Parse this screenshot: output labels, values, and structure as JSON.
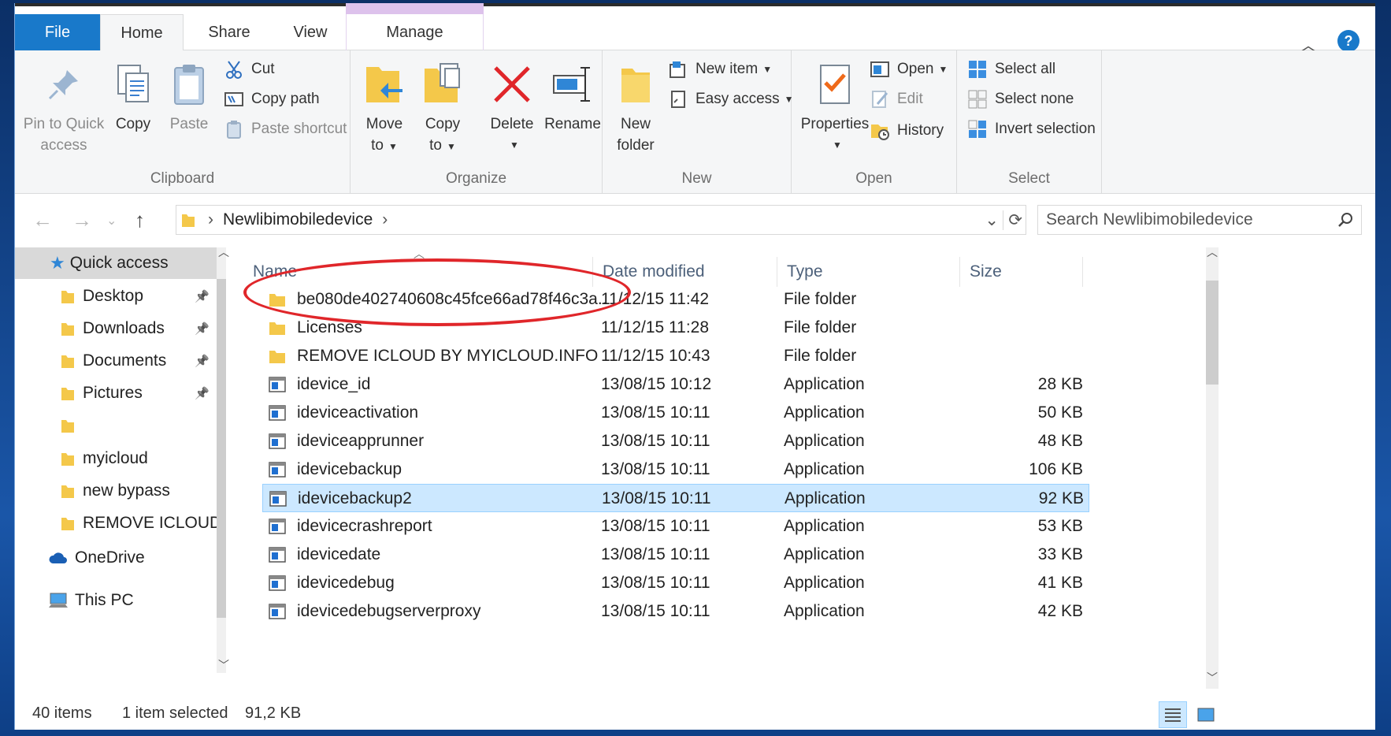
{
  "tabs": {
    "file": "File",
    "home": "Home",
    "share": "Share",
    "view": "View",
    "manage": "Manage"
  },
  "ribbon": {
    "clipboard": {
      "label": "Clipboard",
      "pin_line1": "Pin to Quick",
      "pin_line2": "access",
      "copy": "Copy",
      "paste": "Paste",
      "cut": "Cut",
      "copy_path": "Copy path",
      "paste_shortcut": "Paste shortcut"
    },
    "organize": {
      "label": "Organize",
      "move_line1": "Move",
      "move_line2": "to",
      "copy_line1": "Copy",
      "copy_line2": "to",
      "delete": "Delete",
      "rename": "Rename"
    },
    "new": {
      "label": "New",
      "folder_line1": "New",
      "folder_line2": "folder",
      "new_item": "New item",
      "easy_access": "Easy access"
    },
    "open": {
      "label": "Open",
      "properties": "Properties",
      "open": "Open",
      "edit": "Edit",
      "history": "History"
    },
    "select": {
      "label": "Select",
      "select_all": "Select all",
      "select_none": "Select none",
      "invert": "Invert selection"
    }
  },
  "address": {
    "path": "Newlibimobiledevice",
    "search_placeholder": "Search Newlibimobiledevice"
  },
  "nav": {
    "quick_access": "Quick access",
    "items": [
      {
        "label": "Desktop",
        "pinned": true
      },
      {
        "label": "Downloads",
        "pinned": true
      },
      {
        "label": "Documents",
        "pinned": true
      },
      {
        "label": "Pictures",
        "pinned": true
      },
      {
        "label": "",
        "pinned": false
      },
      {
        "label": "myicloud",
        "pinned": false
      },
      {
        "label": "new bypass",
        "pinned": false
      },
      {
        "label": "REMOVE ICLOUD",
        "pinned": false
      }
    ],
    "onedrive": "OneDrive",
    "this_pc": "This PC"
  },
  "columns": {
    "name": "Name",
    "date": "Date modified",
    "type": "Type",
    "size": "Size"
  },
  "files": [
    {
      "name": "be080de402740608c45fce66ad78f46c3a...",
      "date": "11/12/15 11:42",
      "type": "File folder",
      "size": "",
      "kind": "folder"
    },
    {
      "name": "Licenses",
      "date": "11/12/15 11:28",
      "type": "File folder",
      "size": "",
      "kind": "folder"
    },
    {
      "name": "REMOVE ICLOUD BY MYICLOUD.INFO",
      "date": "11/12/15 10:43",
      "type": "File folder",
      "size": "",
      "kind": "folder"
    },
    {
      "name": "idevice_id",
      "date": "13/08/15 10:12",
      "type": "Application",
      "size": "28 KB",
      "kind": "app"
    },
    {
      "name": "ideviceactivation",
      "date": "13/08/15 10:11",
      "type": "Application",
      "size": "50 KB",
      "kind": "app"
    },
    {
      "name": "ideviceapprunner",
      "date": "13/08/15 10:11",
      "type": "Application",
      "size": "48 KB",
      "kind": "app"
    },
    {
      "name": "idevicebackup",
      "date": "13/08/15 10:11",
      "type": "Application",
      "size": "106 KB",
      "kind": "app"
    },
    {
      "name": "idevicebackup2",
      "date": "13/08/15 10:11",
      "type": "Application",
      "size": "92 KB",
      "kind": "app",
      "selected": true
    },
    {
      "name": "idevicecrashreport",
      "date": "13/08/15 10:11",
      "type": "Application",
      "size": "53 KB",
      "kind": "app"
    },
    {
      "name": "idevicedate",
      "date": "13/08/15 10:11",
      "type": "Application",
      "size": "33 KB",
      "kind": "app"
    },
    {
      "name": "idevicedebug",
      "date": "13/08/15 10:11",
      "type": "Application",
      "size": "41 KB",
      "kind": "app"
    },
    {
      "name": "idevicedebugserverproxy",
      "date": "13/08/15 10:11",
      "type": "Application",
      "size": "42 KB",
      "kind": "app"
    }
  ],
  "status": {
    "count": "40 items",
    "selected": "1 item selected",
    "size": "91,2 KB"
  },
  "colors": {
    "accent": "#1979ca",
    "selection": "#cce8ff",
    "annotation": "#e0262a"
  }
}
